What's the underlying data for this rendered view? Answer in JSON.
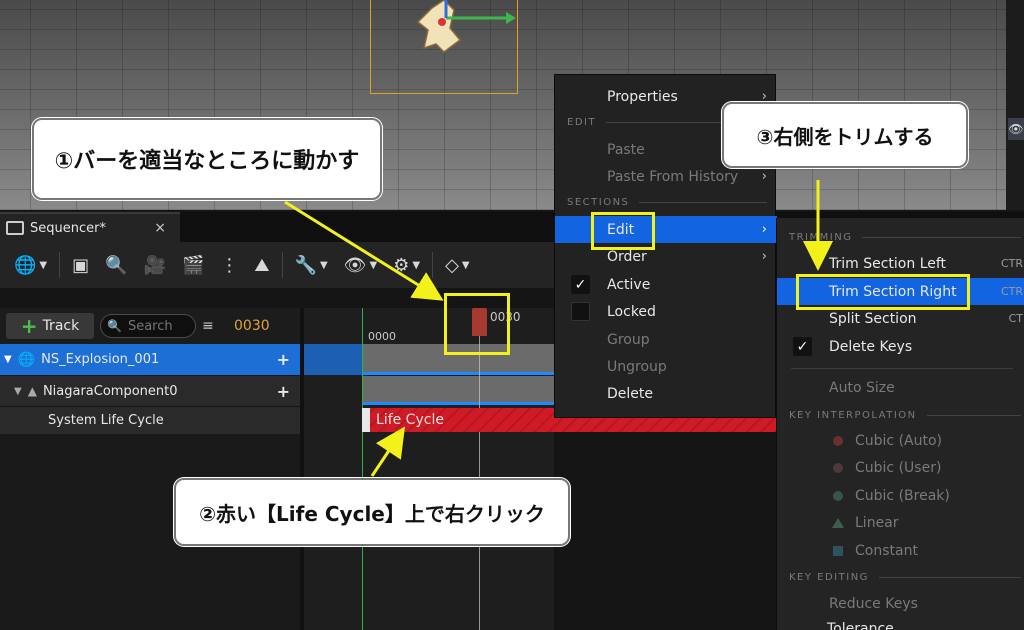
{
  "sequencer": {
    "tab_title": "Sequencer*",
    "tab_close": "×",
    "track_button": "Track",
    "search_placeholder": "Search",
    "frame_counter": "0030",
    "ruler_start": "0000",
    "ruler_playhead": "0030",
    "tracks": [
      {
        "label": "NS_Explosion_001"
      },
      {
        "label": "NiagaraComponent0"
      },
      {
        "label": "System Life Cycle"
      }
    ],
    "section_label": "Life Cycle"
  },
  "context_menu": {
    "properties": "Properties",
    "header_edit": "EDIT",
    "paste": "Paste",
    "paste_history": "Paste From History",
    "header_sections": "SECTIONS",
    "edit": "Edit",
    "order": "Order",
    "active": "Active",
    "locked": "Locked",
    "group": "Group",
    "ungroup": "Ungroup",
    "delete": "Delete"
  },
  "edit_submenu": {
    "header_trimming": "TRIMMING",
    "trim_left": "Trim Section Left",
    "trim_left_shortcut": "CTR",
    "trim_right": "Trim Section Right",
    "trim_right_shortcut": "CTR",
    "split": "Split Section",
    "split_shortcut": "CT",
    "delete_keys": "Delete Keys",
    "auto_size": "Auto Size",
    "header_key_interp": "KEY INTERPOLATION",
    "cubic_auto": "Cubic (Auto)",
    "cubic_user": "Cubic (User)",
    "cubic_break": "Cubic (Break)",
    "linear": "Linear",
    "constant": "Constant",
    "header_key_editing": "KEY EDITING",
    "reduce_keys": "Reduce Keys",
    "tolerance": "Tolerance"
  },
  "annotations": {
    "step1": "①バーを適当なところに動かす",
    "step2": "②赤い【Life Cycle】上で右クリック",
    "step3": "③右側をトリムする"
  },
  "colors": {
    "highlight": "#f2f21a",
    "selection": "#1264e0",
    "section_red": "#cf1b25"
  }
}
